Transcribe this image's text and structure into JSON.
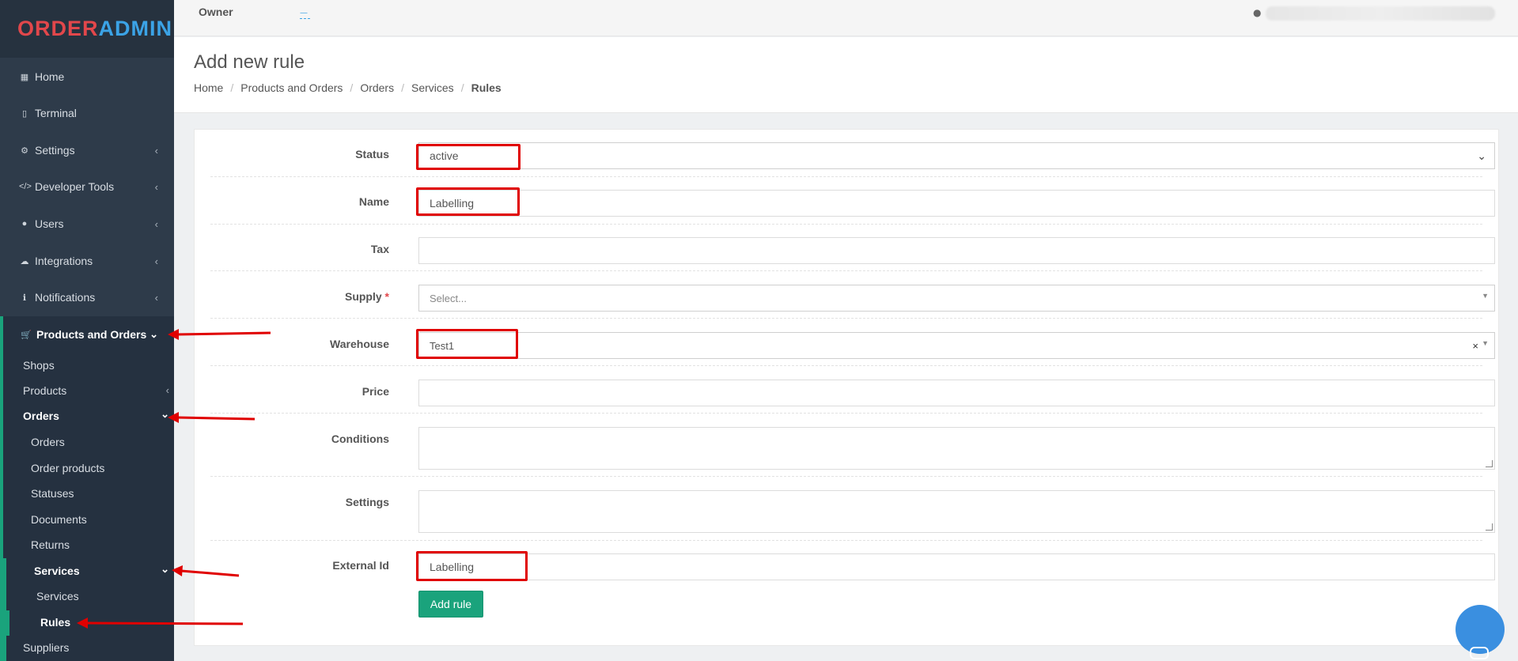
{
  "logo": {
    "part1": "ORDER",
    "part2": "ADMIN"
  },
  "topbar": {
    "owner_label": "Owner",
    "owner_value": "—"
  },
  "sidebar": {
    "items": [
      {
        "label": "Home",
        "icon": "grid-icon"
      },
      {
        "label": "Terminal",
        "icon": "tablet-icon"
      },
      {
        "label": "Settings",
        "icon": "gear-icon"
      },
      {
        "label": "Developer Tools",
        "icon": "code-icon"
      },
      {
        "label": "Users",
        "icon": "user-icon"
      },
      {
        "label": "Integrations",
        "icon": "cloud-icon"
      },
      {
        "label": "Notifications",
        "icon": "info-icon"
      },
      {
        "label": "Products and Orders",
        "icon": "cart-icon"
      }
    ],
    "sub": {
      "shops": "Shops",
      "products": "Products",
      "orders_group": "Orders",
      "orders": "Orders",
      "order_products": "Order products",
      "statuses": "Statuses",
      "documents": "Documents",
      "returns": "Returns",
      "services_group": "Services",
      "services": "Services",
      "rules": "Rules",
      "suppliers": "Suppliers"
    }
  },
  "page": {
    "title": "Add new rule",
    "breadcrumb": [
      "Home",
      "Products and Orders",
      "Orders",
      "Services",
      "Rules"
    ]
  },
  "form": {
    "status_label": "Status",
    "status_value": "active",
    "name_label": "Name",
    "name_value": "Labelling",
    "tax_label": "Tax",
    "tax_value": "",
    "supply_label": "Supply",
    "supply_required": "*",
    "supply_placeholder": "Select...",
    "warehouse_label": "Warehouse",
    "warehouse_value": "Test1",
    "price_label": "Price",
    "price_value": "",
    "conditions_label": "Conditions",
    "settings_label": "Settings",
    "external_id_label": "External Id",
    "external_id_value": "Labelling",
    "submit_label": "Add rule"
  },
  "colors": {
    "accent": "#1aa37c",
    "sidebar": "#2e3b4a",
    "highlight": "#e00000"
  }
}
